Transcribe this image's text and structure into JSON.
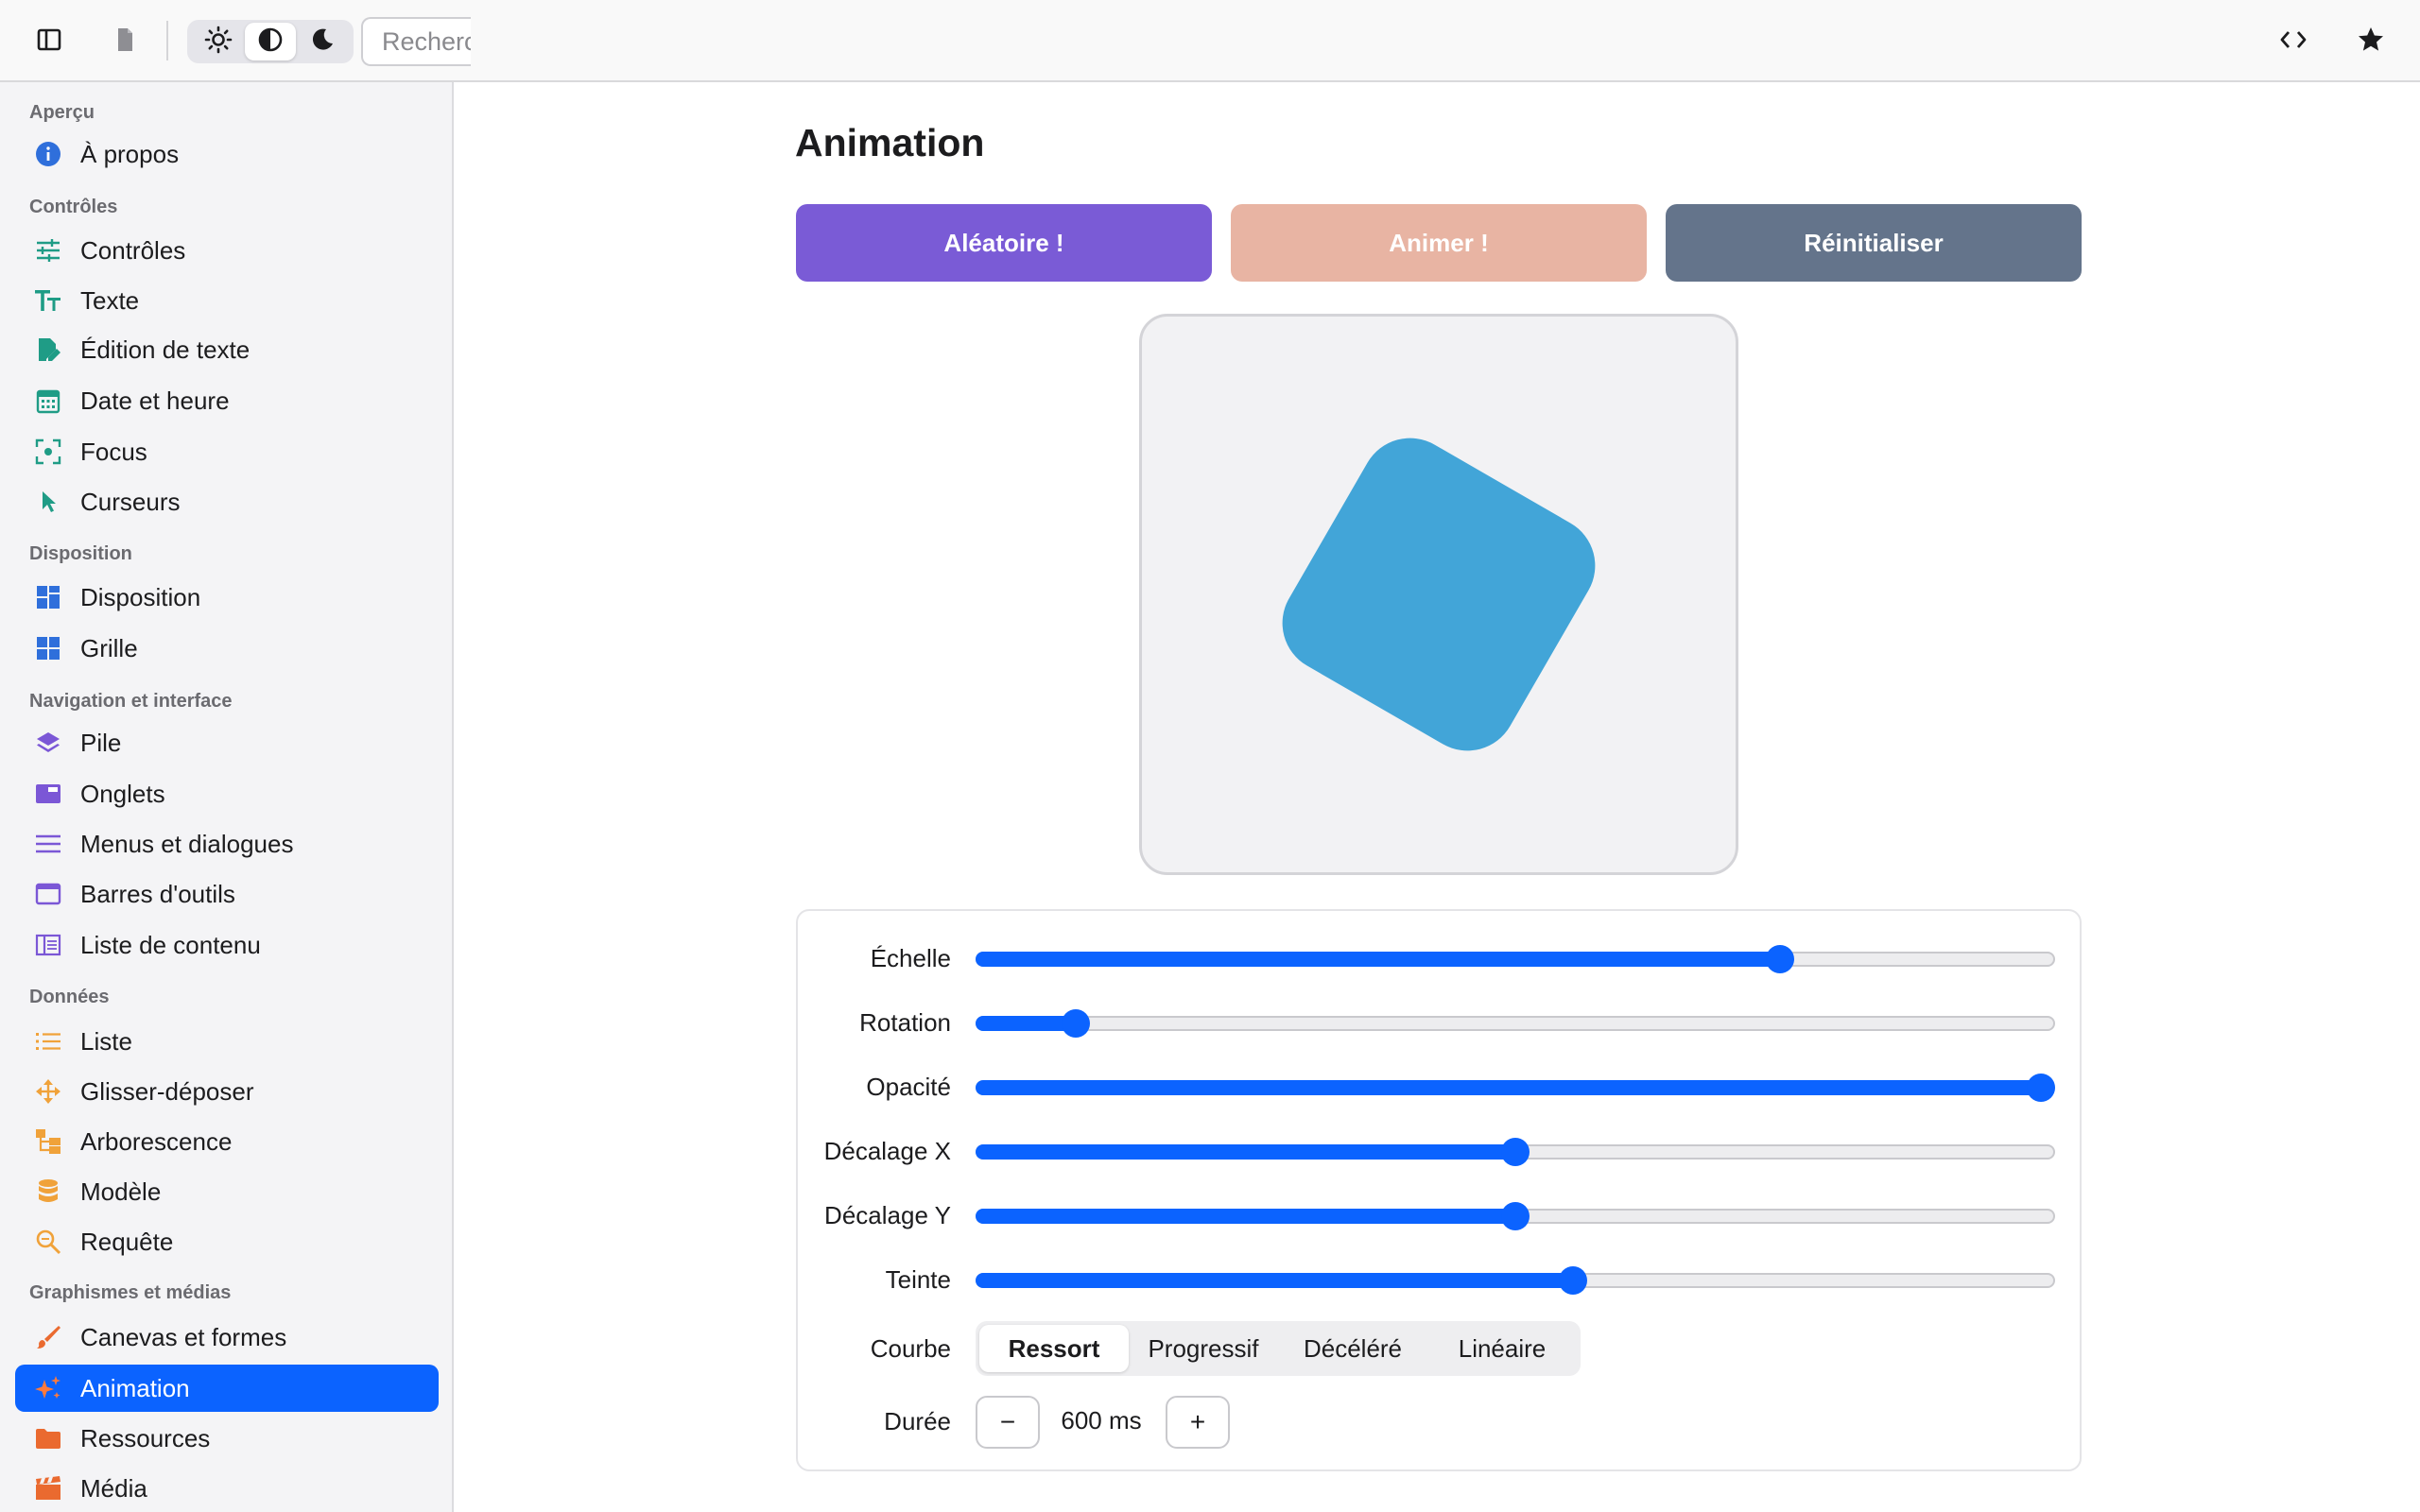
{
  "toolbar": {
    "search_placeholder": "Recherche",
    "icons": [
      "sidebar-toggle-icon",
      "document-icon",
      "sun-icon",
      "contrast-icon",
      "moon-icon",
      "code-icon",
      "star-icon"
    ],
    "theme_selected": "contrast"
  },
  "sidebar": {
    "accent": "#0b63ff",
    "sections": [
      {
        "title": "Aperçu",
        "items": [
          {
            "label": "À propos",
            "icon": "info-icon",
            "color": "#2f6fdb"
          }
        ]
      },
      {
        "title": "Contrôles",
        "items": [
          {
            "label": "Contrôles",
            "icon": "sliders-icon",
            "color": "#1f9c86"
          },
          {
            "label": "Texte",
            "icon": "text-size-icon",
            "color": "#1f9c86"
          },
          {
            "label": "Édition de texte",
            "icon": "edit-document-icon",
            "color": "#1f9c86"
          },
          {
            "label": "Date et heure",
            "icon": "calendar-icon",
            "color": "#1f9c86"
          },
          {
            "label": "Focus",
            "icon": "focus-icon",
            "color": "#1f9c86"
          },
          {
            "label": "Curseurs",
            "icon": "cursor-icon",
            "color": "#1f9c86"
          }
        ]
      },
      {
        "title": "Disposition",
        "items": [
          {
            "label": "Disposition",
            "icon": "layout-icon",
            "color": "#2f6fdb"
          },
          {
            "label": "Grille",
            "icon": "grid-icon",
            "color": "#2f6fdb"
          }
        ]
      },
      {
        "title": "Navigation et interface",
        "items": [
          {
            "label": "Pile",
            "icon": "layers-icon",
            "color": "#7b57d6"
          },
          {
            "label": "Onglets",
            "icon": "tabs-icon",
            "color": "#7b57d6"
          },
          {
            "label": "Menus et dialogues",
            "icon": "menu-lines-icon",
            "color": "#7b57d6"
          },
          {
            "label": "Barres d'outils",
            "icon": "window-icon",
            "color": "#7b57d6"
          },
          {
            "label": "Liste de contenu",
            "icon": "content-list-icon",
            "color": "#7b57d6"
          }
        ]
      },
      {
        "title": "Données",
        "items": [
          {
            "label": "Liste",
            "icon": "list-icon",
            "color": "#f0a23a"
          },
          {
            "label": "Glisser-déposer",
            "icon": "move-icon",
            "color": "#f0a23a"
          },
          {
            "label": "Arborescence",
            "icon": "tree-icon",
            "color": "#f0a23a"
          },
          {
            "label": "Modèle",
            "icon": "database-icon",
            "color": "#f0a23a"
          },
          {
            "label": "Requête",
            "icon": "search-doc-icon",
            "color": "#f0a23a"
          }
        ]
      },
      {
        "title": "Graphismes et médias",
        "items": [
          {
            "label": "Canevas et formes",
            "icon": "brush-icon",
            "color": "#ea6a2f"
          },
          {
            "label": "Animation",
            "icon": "sparkles-icon",
            "color": "#ea6a2f",
            "selected": true
          },
          {
            "label": "Ressources",
            "icon": "folder-icon",
            "color": "#ea6a2f"
          },
          {
            "label": "Média",
            "icon": "clapper-icon",
            "color": "#ea6a2f"
          }
        ]
      }
    ]
  },
  "main": {
    "title": "Animation",
    "buttons": {
      "random": {
        "label": "Aléatoire !",
        "color": "#7a5bd6"
      },
      "animate": {
        "label": "Animer !",
        "color": "#e8b4a3"
      },
      "reset": {
        "label": "Réinitialiser",
        "color": "#64748b"
      }
    },
    "shape": {
      "color": "#42a5d8",
      "rotation_deg": 30,
      "scale": 0.75,
      "opacity": 1.0
    },
    "controls": {
      "sliders": [
        {
          "label": "Échelle",
          "value": 0.745
        },
        {
          "label": "Rotation",
          "value": 0.093
        },
        {
          "label": "Opacité",
          "value": 1.0
        },
        {
          "label": "Décalage X",
          "value": 0.5
        },
        {
          "label": "Décalage Y",
          "value": 0.5
        },
        {
          "label": "Teinte",
          "value": 0.553
        }
      ],
      "curve": {
        "label": "Courbe",
        "options": [
          "Ressort",
          "Progressif",
          "Décéléré",
          "Linéaire"
        ],
        "selected": "Ressort"
      },
      "duration": {
        "label": "Durée",
        "value": "600 ms",
        "decrement": "−",
        "increment": "+"
      }
    }
  }
}
